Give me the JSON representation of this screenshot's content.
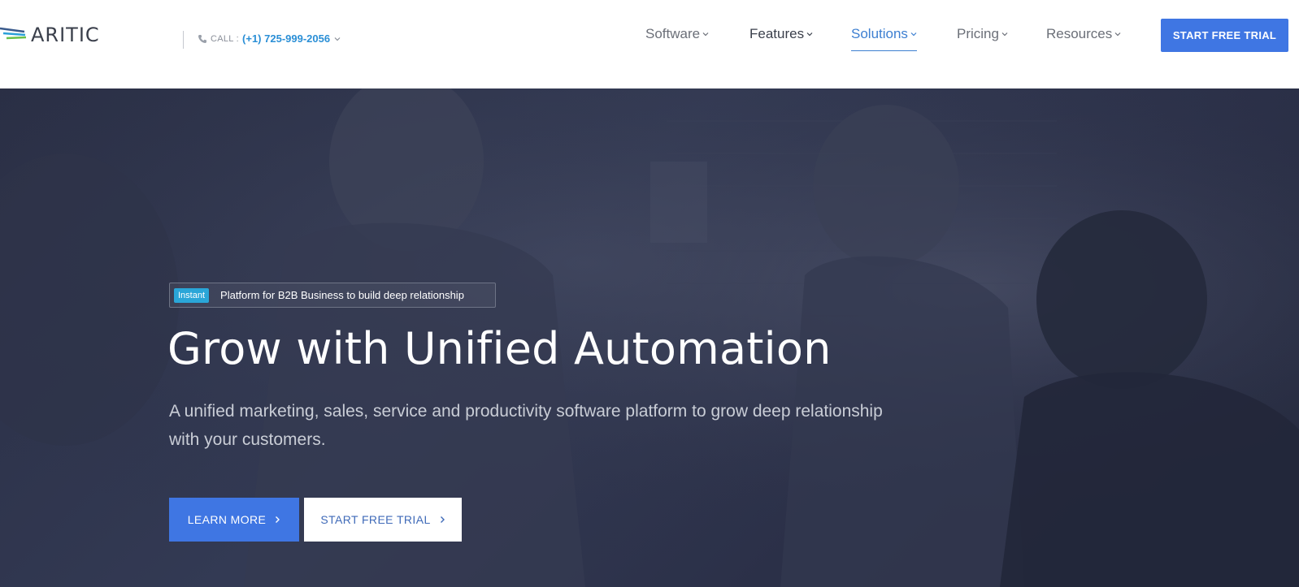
{
  "brand": {
    "name": "ARITIC"
  },
  "contact": {
    "label": "CALL :",
    "number": "(+1) 725-999-2056"
  },
  "nav": {
    "items": [
      {
        "label": "Software"
      },
      {
        "label": "Features"
      },
      {
        "label": "Solutions"
      },
      {
        "label": "Pricing"
      },
      {
        "label": "Resources"
      }
    ],
    "active": "Solutions",
    "cta_label": "START FREE TRIAL"
  },
  "hero": {
    "badge_tag": "Instant",
    "badge_text": "Platform for B2B Business to build deep relationship",
    "title": "Grow with Unified Automation",
    "subtitle": "A unified marketing, sales, service and productivity software platform to grow deep relationship with your customers.",
    "learn_more_label": "LEARN MORE",
    "trial_label": "START FREE TRIAL"
  },
  "colors": {
    "accent": "#3f76e3",
    "phone": "#2b8fd6",
    "badge": "#2aa6d8",
    "hero_overlay": "#2a2f45"
  },
  "icons": [
    "logo-wing-icon",
    "phone-icon",
    "chevron-down-icon",
    "chevron-right-icon"
  ]
}
